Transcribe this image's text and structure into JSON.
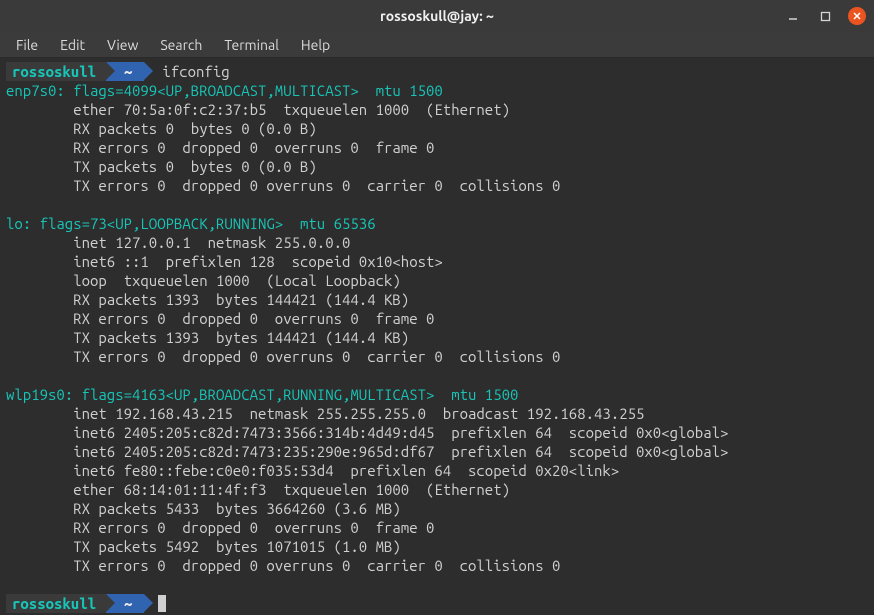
{
  "window": {
    "title": "rossoskull@jay: ~"
  },
  "menu": {
    "file": "File",
    "edit": "Edit",
    "view": "View",
    "search": "Search",
    "terminal": "Terminal",
    "help": "Help"
  },
  "prompt": {
    "user": "rossoskull",
    "path": "~",
    "command": "ifconfig"
  },
  "output": {
    "enp7s0_header": "enp7s0: flags=4099<UP,BROADCAST,MULTICAST>  mtu 1500",
    "enp7s0_l1": "        ether 70:5a:0f:c2:37:b5  txqueuelen 1000  (Ethernet)",
    "enp7s0_l2": "        RX packets 0  bytes 0 (0.0 B)",
    "enp7s0_l3": "        RX errors 0  dropped 0  overruns 0  frame 0",
    "enp7s0_l4": "        TX packets 0  bytes 0 (0.0 B)",
    "enp7s0_l5": "        TX errors 0  dropped 0 overruns 0  carrier 0  collisions 0",
    "blank1": " ",
    "lo_header": "lo: flags=73<UP,LOOPBACK,RUNNING>  mtu 65536",
    "lo_l1": "        inet 127.0.0.1  netmask 255.0.0.0",
    "lo_l2": "        inet6 ::1  prefixlen 128  scopeid 0x10<host>",
    "lo_l3": "        loop  txqueuelen 1000  (Local Loopback)",
    "lo_l4": "        RX packets 1393  bytes 144421 (144.4 KB)",
    "lo_l5": "        RX errors 0  dropped 0  overruns 0  frame 0",
    "lo_l6": "        TX packets 1393  bytes 144421 (144.4 KB)",
    "lo_l7": "        TX errors 0  dropped 0 overruns 0  carrier 0  collisions 0",
    "blank2": " ",
    "wlp_header": "wlp19s0: flags=4163<UP,BROADCAST,RUNNING,MULTICAST>  mtu 1500",
    "wlp_l1": "        inet 192.168.43.215  netmask 255.255.255.0  broadcast 192.168.43.255",
    "wlp_l2": "        inet6 2405:205:c82d:7473:3566:314b:4d49:d45  prefixlen 64  scopeid 0x0<global>",
    "wlp_l3": "        inet6 2405:205:c82d:7473:235:290e:965d:df67  prefixlen 64  scopeid 0x0<global>",
    "wlp_l4": "        inet6 fe80::febe:c0e0:f035:53d4  prefixlen 64  scopeid 0x20<link>",
    "wlp_l5": "        ether 68:14:01:11:4f:f3  txqueuelen 1000  (Ethernet)",
    "wlp_l6": "        RX packets 5433  bytes 3664260 (3.6 MB)",
    "wlp_l7": "        RX errors 0  dropped 0  overruns 0  frame 0",
    "wlp_l8": "        TX packets 5492  bytes 1071015 (1.0 MB)",
    "wlp_l9": "        TX errors 0  dropped 0 overruns 0  carrier 0  collisions 0",
    "blank3": " "
  },
  "prompt2": {
    "user": "rossoskull",
    "path": "~"
  }
}
